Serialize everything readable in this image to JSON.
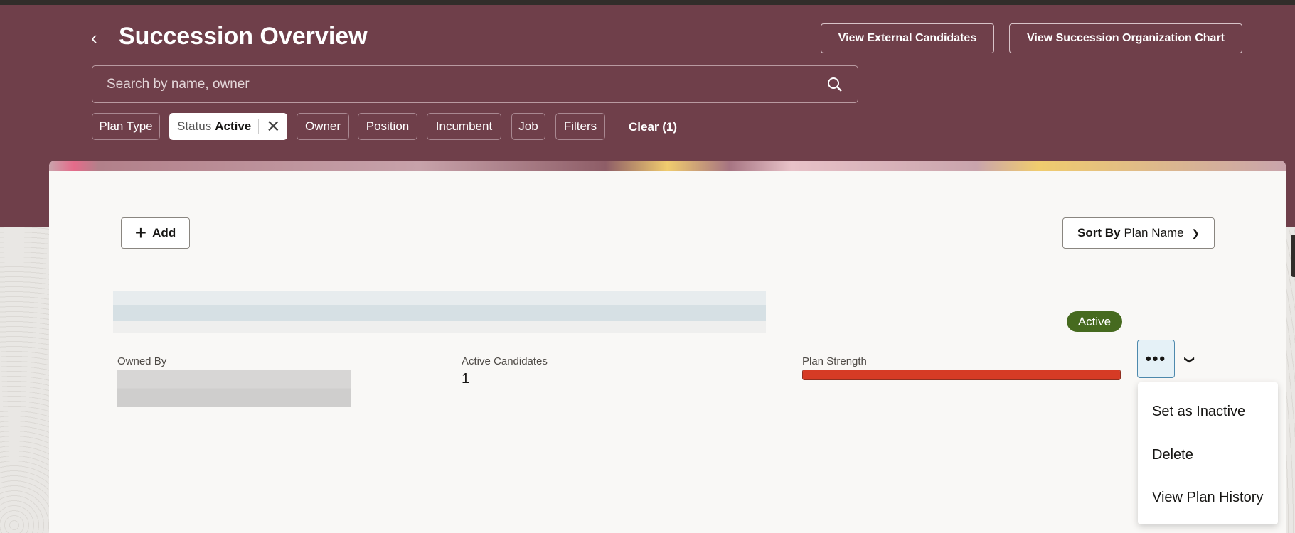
{
  "header": {
    "title": "Succession Overview",
    "buttons": {
      "external": "View External Candidates",
      "org_chart": "View Succession Organization Chart"
    },
    "search_placeholder": "Search by name, owner",
    "filters": {
      "plan_type": "Plan Type",
      "status_key": "Status",
      "status_value": "Active",
      "owner": "Owner",
      "position": "Position",
      "incumbent": "Incumbent",
      "job": "Job",
      "filters": "Filters",
      "clear": "Clear (1)"
    }
  },
  "toolbar": {
    "add": "Add",
    "sort_key": "Sort By",
    "sort_value": "Plan Name"
  },
  "plan": {
    "status": "Active",
    "owned_by_label": "Owned By",
    "active_candidates_label": "Active Candidates",
    "active_candidates": "1",
    "plan_strength_label": "Plan Strength",
    "plan_strength_percent": 100,
    "plan_strength_color": "#d63b25"
  },
  "menu": {
    "items": [
      "Set as Inactive",
      "Delete",
      "View Plan History"
    ]
  }
}
